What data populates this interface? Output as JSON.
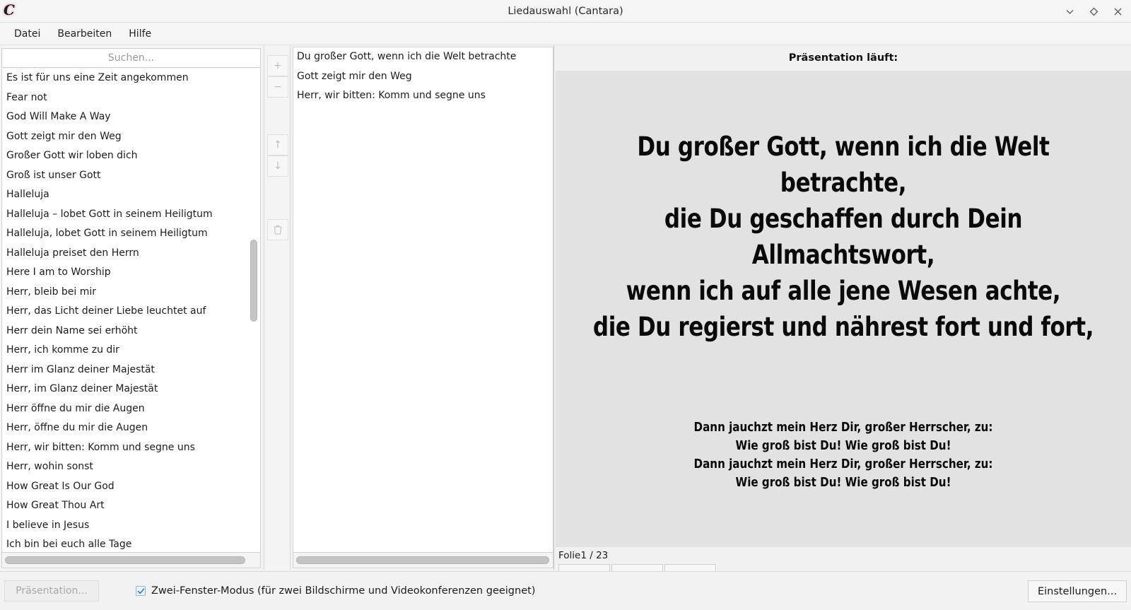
{
  "window": {
    "title": "Liedauswahl (Cantara)",
    "logo": "C",
    "controls": [
      {
        "name": "minimize-icon",
        "glyph": "chevron-down"
      },
      {
        "name": "maximize-icon",
        "glyph": "diamond"
      },
      {
        "name": "close-icon",
        "glyph": "x"
      }
    ]
  },
  "menu": {
    "items": [
      {
        "label": "Datei"
      },
      {
        "label": "Bearbeiten"
      },
      {
        "label": "Hilfe"
      }
    ]
  },
  "search": {
    "placeholder": "Suchen...",
    "value": ""
  },
  "song_library": {
    "items": [
      "Es ist für uns eine Zeit angekommen",
      "Fear not",
      "God Will Make A Way",
      "Gott zeigt mir den Weg",
      "Großer Gott wir loben dich",
      "Groß ist unser Gott",
      "Halleluja",
      "Halleluja – lobet Gott in seinem Heiligtum",
      "Halleluja, lobet Gott in seinem Heiligtum",
      "Halleluja preiset den Herrn",
      "Here I am to Worship",
      "Herr, bleib bei mir",
      "Herr, das Licht deiner Liebe leuchtet auf",
      "Herr dein Name sei erhöht",
      "Herr, ich komme zu dir",
      "Herr im Glanz deiner Majestät",
      "Herr, im Glanz deiner Majestät",
      "Herr öffne du mir die Augen",
      "Herr, öffne du mir die Augen",
      "Herr, wir bitten: Komm und segne uns",
      "Herr, wohin sonst",
      "How Great Is Our God",
      "How Great Thou Art",
      "I believe in Jesus",
      "Ich bin bei euch alle Tage"
    ]
  },
  "transfer_buttons": [
    {
      "name": "add-song-button",
      "label": "+",
      "enabled": false
    },
    {
      "name": "remove-song-button",
      "label": "−",
      "enabled": false
    },
    {
      "name": "move-up-button",
      "label": "↑",
      "enabled": false
    },
    {
      "name": "move-down-button",
      "label": "↓",
      "enabled": false
    },
    {
      "name": "delete-all-button",
      "label": "trash-icon",
      "enabled": false
    }
  ],
  "selected_songs": {
    "items": [
      "Du großer Gott, wenn ich die Welt betrachte",
      "Gott zeigt mir den Weg",
      "Herr, wir bitten: Komm und segne uns"
    ]
  },
  "presentation": {
    "status": "Präsentation läuft:",
    "slide_verse_lines": [
      "Du großer Gott, wenn ich die Welt",
      "betrachte,",
      "die Du geschaffen durch Dein",
      "Allmachtswort,",
      "wenn ich auf alle jene Wesen achte,",
      "die Du regierst und nährest fort und fort,"
    ],
    "slide_chorus_lines": [
      "Dann jauchzt mein Herz Dir, großer Herrscher, zu:",
      "Wie groß bist Du! Wie groß bist Du!",
      "Dann jauchzt mein Herz Dir, großer Herrscher, zu:",
      "Wie groß bist Du! Wie groß bist Du!"
    ],
    "slide_counter": "Folie1 / 23",
    "nav": {
      "prev_label": "←",
      "next_label": "→",
      "close_label": "×"
    }
  },
  "bottom_bar": {
    "presentation_button": "Präsentation...",
    "two_window_label": "Zwei-Fenster-Modus (für zwei Bildschirme und Videokonferenzen geeignet)",
    "two_window_checked": true,
    "settings_button": "Einstellungen..."
  },
  "colors": {
    "window_bg": "#f2f2f2",
    "list_bg": "#ffffff",
    "slide_bg": "#e2e2e2",
    "checkbox_accent": "#3a7bd5",
    "text": "#1c1c1c"
  }
}
